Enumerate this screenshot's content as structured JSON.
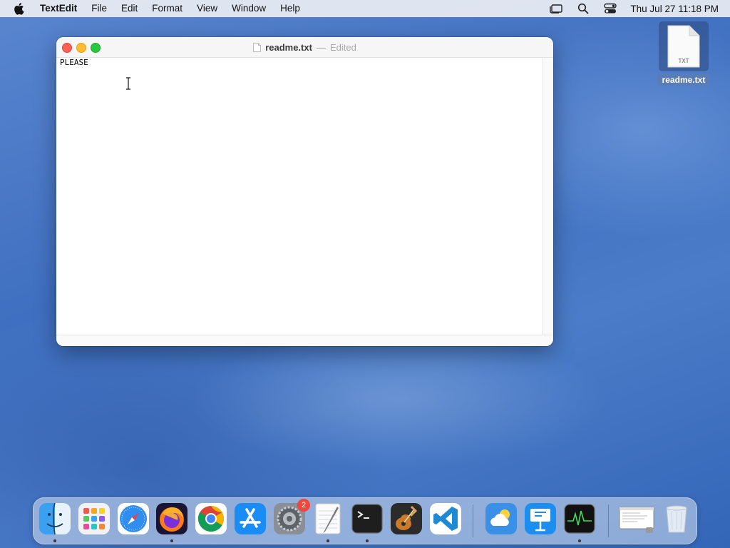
{
  "menubar": {
    "app_name": "TextEdit",
    "menus": [
      "File",
      "Edit",
      "Format",
      "View",
      "Window",
      "Help"
    ],
    "clock": "Thu Jul 27  11:18 PM"
  },
  "window": {
    "title": "readme.txt",
    "separator": "—",
    "status": "Edited",
    "content": "PLEASE"
  },
  "desktop": {
    "file_label": "readme.txt",
    "file_type": "TXT"
  },
  "dock": {
    "items": [
      {
        "name": "finder-icon",
        "running": true
      },
      {
        "name": "launchpad-icon",
        "running": false
      },
      {
        "name": "safari-icon",
        "running": false
      },
      {
        "name": "firefox-icon",
        "running": true
      },
      {
        "name": "chrome-icon",
        "running": false
      },
      {
        "name": "app-store-icon",
        "running": false
      },
      {
        "name": "system-settings-icon",
        "running": false,
        "badge": "2"
      },
      {
        "name": "textedit-icon",
        "running": true
      },
      {
        "name": "terminal-icon",
        "running": true
      },
      {
        "name": "garageband-icon",
        "running": false
      },
      {
        "name": "vscode-icon",
        "running": false
      },
      {
        "name": "weather-icon",
        "running": false
      },
      {
        "name": "keynote-icon",
        "running": false
      },
      {
        "name": "activity-monitor-icon",
        "running": true
      },
      {
        "name": "minimized-window-icon",
        "running": false
      },
      {
        "name": "trash-icon",
        "running": false
      }
    ]
  },
  "colors": {
    "close": "#fe5f57",
    "minimize": "#febc2e",
    "maximize": "#28c840",
    "badge": "#f0463c"
  }
}
